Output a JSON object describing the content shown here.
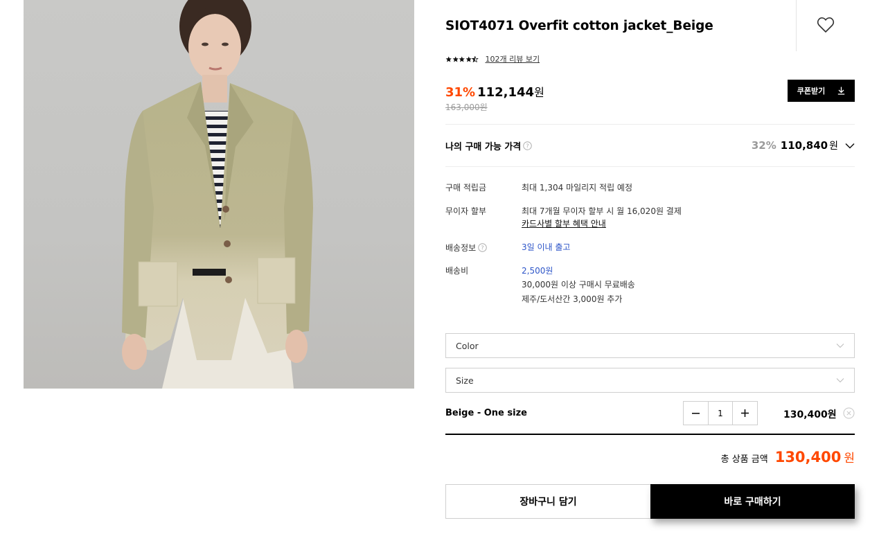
{
  "product": {
    "title": "SIOT4071 Overfit cotton jacket_Beige",
    "rating": 4.5,
    "review_link": "102개 리뷰 보기",
    "discount": "31%",
    "price": "112,144",
    "price_unit": "원",
    "original_price": "163,000원"
  },
  "coupon": {
    "label": "쿠폰받기",
    "icon": "download-icon"
  },
  "my_price": {
    "label": "나의 구매 가능 가격",
    "discount": "32%",
    "price": "110,840",
    "unit": "원"
  },
  "info": {
    "points_label": "구매 적립금",
    "points_value": "최대 1,304 마일리지 적립 예정",
    "installment_label": "무이자 할부",
    "installment_value": "최대 7개월 무이자 할부 시 월 16,020원 결제",
    "installment_link": "카드사별 할부 혜택 안내",
    "shipping_label": "배송정보",
    "shipping_value": "3일 이내 출고",
    "fee_label": "배송비",
    "fee_value": "2,500원",
    "fee_note1": "30,000원 이상 구매시 무료배송",
    "fee_note2": "제주/도서산간 3,000원 추가"
  },
  "options": {
    "color_placeholder": "Color",
    "size_placeholder": "Size"
  },
  "selected": {
    "name": "Beige - One size",
    "quantity": "1",
    "price": "130,400원"
  },
  "total": {
    "label": "총 상품 금액",
    "value": "130,400",
    "unit": "원"
  },
  "actions": {
    "cart": "장바구니 담기",
    "buy": "바로 구매하기"
  },
  "colors": {
    "accent": "#ff4800",
    "link_blue": "#2d55c8"
  }
}
